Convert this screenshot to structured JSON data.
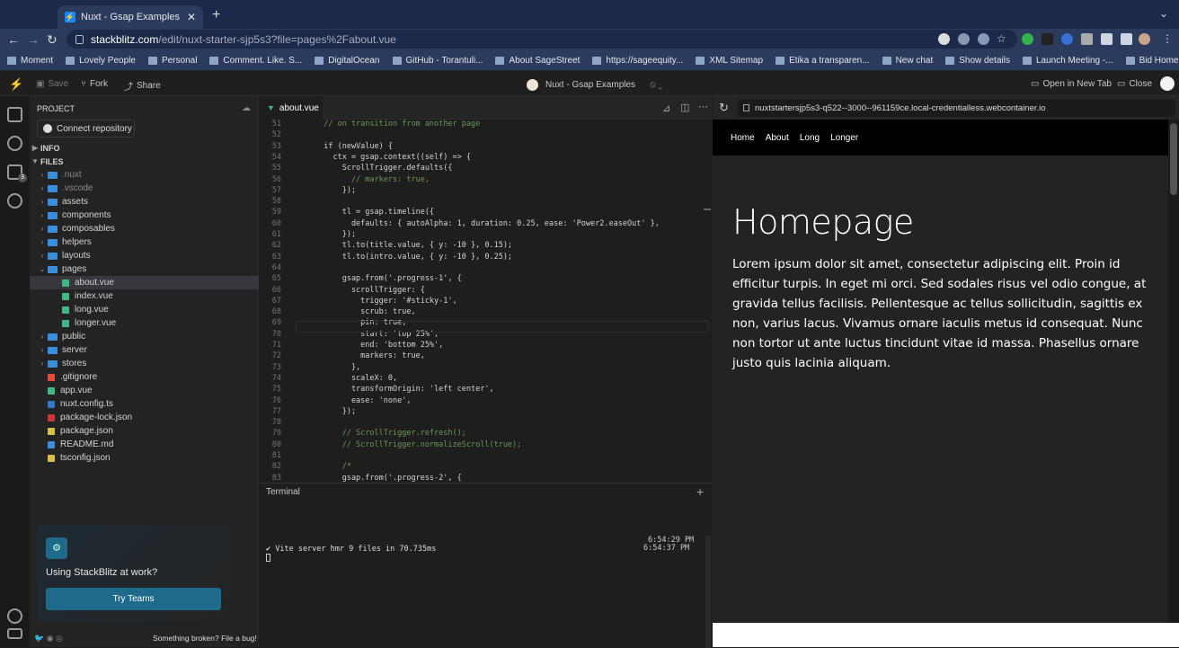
{
  "browser": {
    "tab_title": "Nuxt - Gsap Examples - StackB",
    "url_host": "stackblitz.com",
    "url_path": "/edit/nuxt-starter-sjp5s3?file=pages%2Fabout.vue",
    "bookmarks": [
      "Moment",
      "Lovely People",
      "Personal",
      "Comment. Like. S...",
      "DigitalOcean",
      "GitHub - Torantuli...",
      "About SageStreet",
      "https://sageequity...",
      "XML Sitemap",
      "Etika a transparen...",
      "New chat",
      "Show details",
      "Launch Meeting -...",
      "Bid Home"
    ]
  },
  "stackblitz": {
    "save": "Save",
    "fork": "Fork",
    "share": "Share",
    "project_title": "Nuxt - Gsap Examples",
    "open_new_tab": "Open in New Tab",
    "close": "Close",
    "preview_url": "nuxtstartersjp5s3-q522--3000--961159ce.local-credentialless.webcontainer.io"
  },
  "sidebar": {
    "project_label": "PROJECT",
    "connect_repo": "Connect repository",
    "info_label": "INFO",
    "files_label": "FILES",
    "tree": [
      {
        "name": ".nuxt",
        "kind": "folder",
        "open": false,
        "depth": 0
      },
      {
        "name": ".vscode",
        "kind": "folder",
        "open": false,
        "depth": 0
      },
      {
        "name": "assets",
        "kind": "folder",
        "open": false,
        "depth": 0
      },
      {
        "name": "components",
        "kind": "folder",
        "open": false,
        "depth": 0
      },
      {
        "name": "composables",
        "kind": "folder",
        "open": false,
        "depth": 0
      },
      {
        "name": "helpers",
        "kind": "folder",
        "open": false,
        "depth": 0
      },
      {
        "name": "layouts",
        "kind": "folder",
        "open": false,
        "depth": 0
      },
      {
        "name": "pages",
        "kind": "folder",
        "open": true,
        "depth": 0
      },
      {
        "name": "about.vue",
        "kind": "vue",
        "depth": 1,
        "active": true
      },
      {
        "name": "index.vue",
        "kind": "vue",
        "depth": 1
      },
      {
        "name": "long.vue",
        "kind": "vue",
        "depth": 1
      },
      {
        "name": "longer.vue",
        "kind": "vue",
        "depth": 1
      },
      {
        "name": "public",
        "kind": "folder",
        "open": false,
        "depth": 0
      },
      {
        "name": "server",
        "kind": "folder",
        "open": false,
        "depth": 0
      },
      {
        "name": "stores",
        "kind": "folder",
        "open": false,
        "depth": 0
      },
      {
        "name": ".gitignore",
        "kind": "git",
        "depth": 0
      },
      {
        "name": "app.vue",
        "kind": "vue",
        "depth": 0
      },
      {
        "name": "nuxt.config.ts",
        "kind": "ts",
        "depth": 0
      },
      {
        "name": "package-lock.json",
        "kind": "npm",
        "depth": 0
      },
      {
        "name": "package.json",
        "kind": "json",
        "depth": 0
      },
      {
        "name": "README.md",
        "kind": "info",
        "depth": 0
      },
      {
        "name": "tsconfig.json",
        "kind": "json",
        "depth": 0
      }
    ],
    "promo_text": "Using StackBlitz at work?",
    "promo_button": "Try Teams",
    "footer_link": "Something broken? File a bug!"
  },
  "editor": {
    "tab": "about.vue",
    "lines": [
      {
        "n": "51",
        "t": "  // on transition from another page"
      },
      {
        "n": "52",
        "t": ""
      },
      {
        "n": "53",
        "t": "  if (newValue) {"
      },
      {
        "n": "54",
        "t": "    ctx = gsap.context((self) => {"
      },
      {
        "n": "55",
        "t": "      ScrollTrigger.defaults({"
      },
      {
        "n": "56",
        "t": "        // markers: true,"
      },
      {
        "n": "57",
        "t": "      });"
      },
      {
        "n": "58",
        "t": ""
      },
      {
        "n": "59",
        "t": "      tl = gsap.timeline({"
      },
      {
        "n": "60",
        "t": "        defaults: { autoAlpha: 1, duration: 0.25, ease: 'Power2.easeOut' },"
      },
      {
        "n": "61",
        "t": "      });"
      },
      {
        "n": "62",
        "t": "      tl.to(title.value, { y: -10 }, 0.15);"
      },
      {
        "n": "63",
        "t": "      tl.to(intro.value, { y: -10 }, 0.25);"
      },
      {
        "n": "64",
        "t": ""
      },
      {
        "n": "65",
        "t": "      gsap.from('.progress-1', {"
      },
      {
        "n": "66",
        "t": "        scrollTrigger: {"
      },
      {
        "n": "67",
        "t": "          trigger: '#sticky-1',"
      },
      {
        "n": "68",
        "t": "          scrub: true,"
      },
      {
        "n": "69",
        "t": "          pin: true,"
      },
      {
        "n": "70",
        "t": "          start: 'top 25%',"
      },
      {
        "n": "71",
        "t": "          end: 'bottom 25%',"
      },
      {
        "n": "72",
        "t": "          markers: true,"
      },
      {
        "n": "73",
        "t": "        },"
      },
      {
        "n": "74",
        "t": "        scaleX: 0,"
      },
      {
        "n": "75",
        "t": "        transformOrigin: 'left center',"
      },
      {
        "n": "76",
        "t": "        ease: 'none',"
      },
      {
        "n": "77",
        "t": "      });"
      },
      {
        "n": "78",
        "t": ""
      },
      {
        "n": "79",
        "t": "      // ScrollTrigger.refresh();"
      },
      {
        "n": "80",
        "t": "      // ScrollTrigger.normalizeScroll(true);"
      },
      {
        "n": "81",
        "t": ""
      },
      {
        "n": "82",
        "t": "      /*"
      },
      {
        "n": "83",
        "t": "      gsap.from('.progress-2', {"
      }
    ]
  },
  "terminal": {
    "label": "Terminal",
    "time1": "6:54:29 PM",
    "time2": "6:54:37 PM",
    "message": "✔ Vite server hmr 9 files in 70.735ms"
  },
  "preview": {
    "nav": [
      "Home",
      "About",
      "Long",
      "Longer"
    ],
    "title": "Homepage",
    "text": "Lorem ipsum dolor sit amet, consectetur adipiscing elit. Proin id efficitur turpis. In eget mi orci. Sed sodales risus vel odio congue, at gravida tellus facilisis. Pellentesque ac tellus sollicitudin, sagittis ex non, varius lacus. Vivamus ornare iaculis metus id consequat. Nunc non tortor ut ante luctus tincidunt vitae id massa. Phasellus ornare justo quis lacinia aliquam."
  },
  "colors": {
    "accent": "#1389fd",
    "promo_button": "#1e6a8a",
    "folder": "#3b8edb",
    "vue": "#41b883"
  }
}
